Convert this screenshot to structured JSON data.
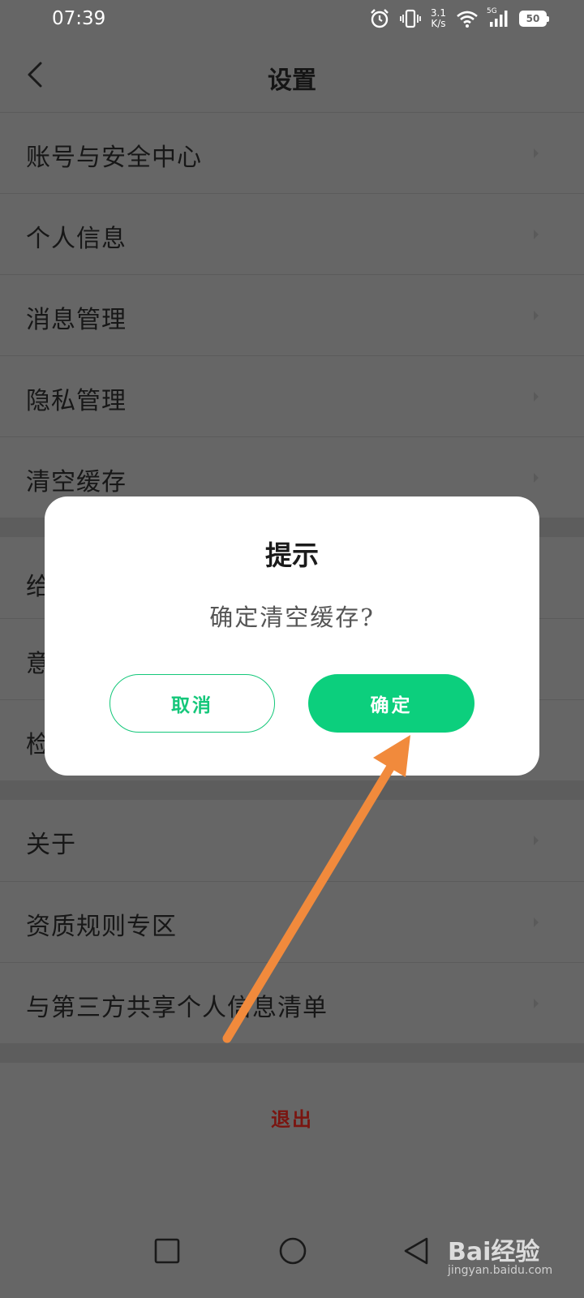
{
  "status_bar": {
    "time": "07:39",
    "net_speed_value": "3.1",
    "net_speed_unit": "K/s",
    "network_type": "5G",
    "battery": "50"
  },
  "header": {
    "title": "设置",
    "back_icon": "chevron-left-icon"
  },
  "settings": {
    "group1": [
      {
        "label": "账号与安全中心"
      },
      {
        "label": "个人信息"
      },
      {
        "label": "消息管理"
      },
      {
        "label": "隐私管理"
      },
      {
        "label": "清空缓存"
      }
    ],
    "group2_partial": [
      {
        "label": "给"
      },
      {
        "label": "意"
      },
      {
        "label": "检"
      }
    ],
    "group3": [
      {
        "label": "关于"
      },
      {
        "label": "资质规则专区"
      },
      {
        "label": "与第三方共享个人信息清单"
      }
    ],
    "logout_label": "退出"
  },
  "dialog": {
    "title": "提示",
    "message": "确定清空缓存?",
    "cancel_label": "取消",
    "confirm_label": "确定"
  },
  "watermark": {
    "brand": "Bai经验",
    "url": "jingyan.baidu.com"
  },
  "colors": {
    "accent_green": "#0ccf7d",
    "logout_red": "#7a1510",
    "annotation_arrow": "#f18a3c"
  }
}
